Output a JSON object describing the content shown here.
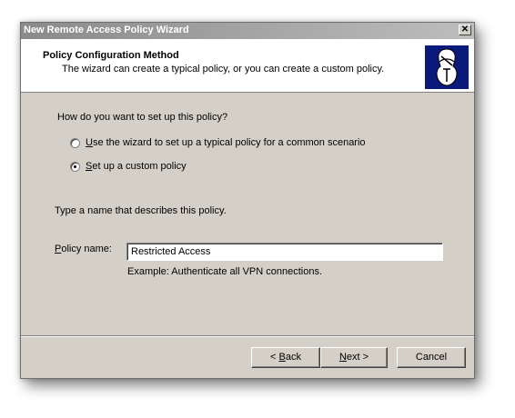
{
  "window": {
    "title": "New Remote Access Policy Wizard",
    "close_glyph": "✕"
  },
  "header": {
    "title": "Policy Configuration Method",
    "subtitle": "The wizard can create a typical policy, or you can create a custom policy.",
    "icon": "wizard-icon"
  },
  "question": {
    "label": "How do you want to set up this policy?",
    "options": [
      {
        "mnemonic": "U",
        "rest": "se the wizard to set up a typical policy for a common scenario",
        "checked": false
      },
      {
        "mnemonic": "S",
        "rest": "et up a custom policy",
        "checked": true
      }
    ]
  },
  "name_section": {
    "instruction": "Type a name that describes this policy.",
    "label_mnemonic": "P",
    "label_rest": "olicy name:",
    "value": "Restricted Access",
    "example": "Example: Authenticate all VPN connections."
  },
  "buttons": {
    "back_prefix": "< ",
    "back_mnemonic": "B",
    "back_rest": "ack",
    "next_mnemonic": "N",
    "next_rest": "ext >",
    "cancel": "Cancel"
  }
}
